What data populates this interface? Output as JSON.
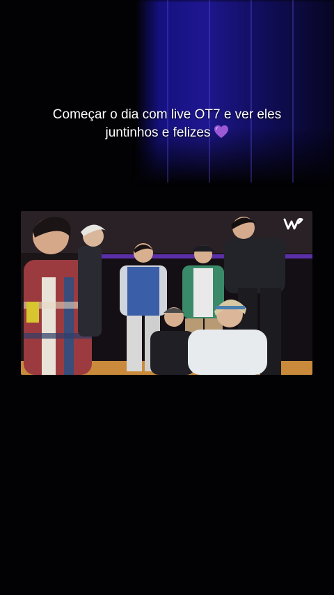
{
  "caption": {
    "line1": "Começar o dia com live OT7 e ver eles",
    "line2": "juntinhos e felizes"
  },
  "icons": {
    "heart": "purple-heart-icon",
    "logo": "weverse-logo-icon"
  },
  "colors": {
    "background": "#020205",
    "glow": "#2a1fb8",
    "heart": "#9b59d6",
    "stage_strip": "#5b2fa8",
    "floor": "#c98a3c"
  }
}
